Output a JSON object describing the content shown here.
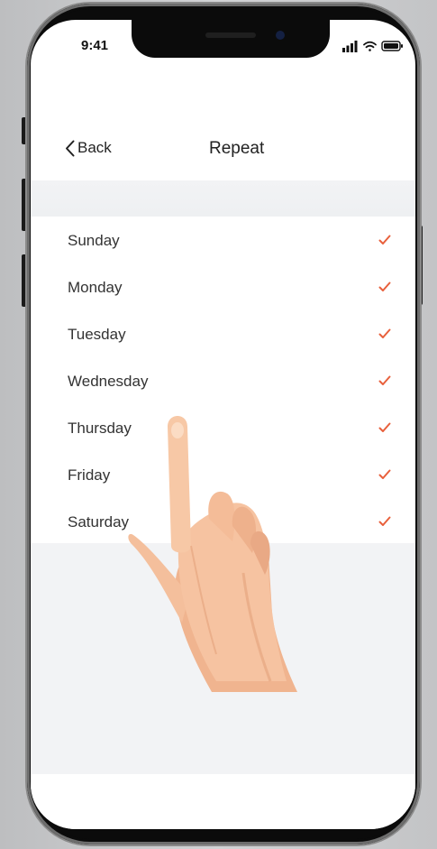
{
  "status_bar": {
    "time": "9:41"
  },
  "nav": {
    "back_label": "Back",
    "title": "Repeat"
  },
  "days": [
    {
      "label": "Sunday",
      "checked": true
    },
    {
      "label": "Monday",
      "checked": true
    },
    {
      "label": "Tuesday",
      "checked": true
    },
    {
      "label": "Wednesday",
      "checked": true
    },
    {
      "label": "Thursday",
      "checked": true
    },
    {
      "label": "Friday",
      "checked": true
    },
    {
      "label": "Saturday",
      "checked": true
    }
  ],
  "icons": {
    "back": "chevron-left-icon",
    "check": "checkmark-icon",
    "signal": "signal-icon",
    "wifi": "wifi-icon",
    "battery": "battery-icon"
  },
  "colors": {
    "check": "#e8603c",
    "background_band": "#f2f3f5",
    "text": "#333333"
  }
}
